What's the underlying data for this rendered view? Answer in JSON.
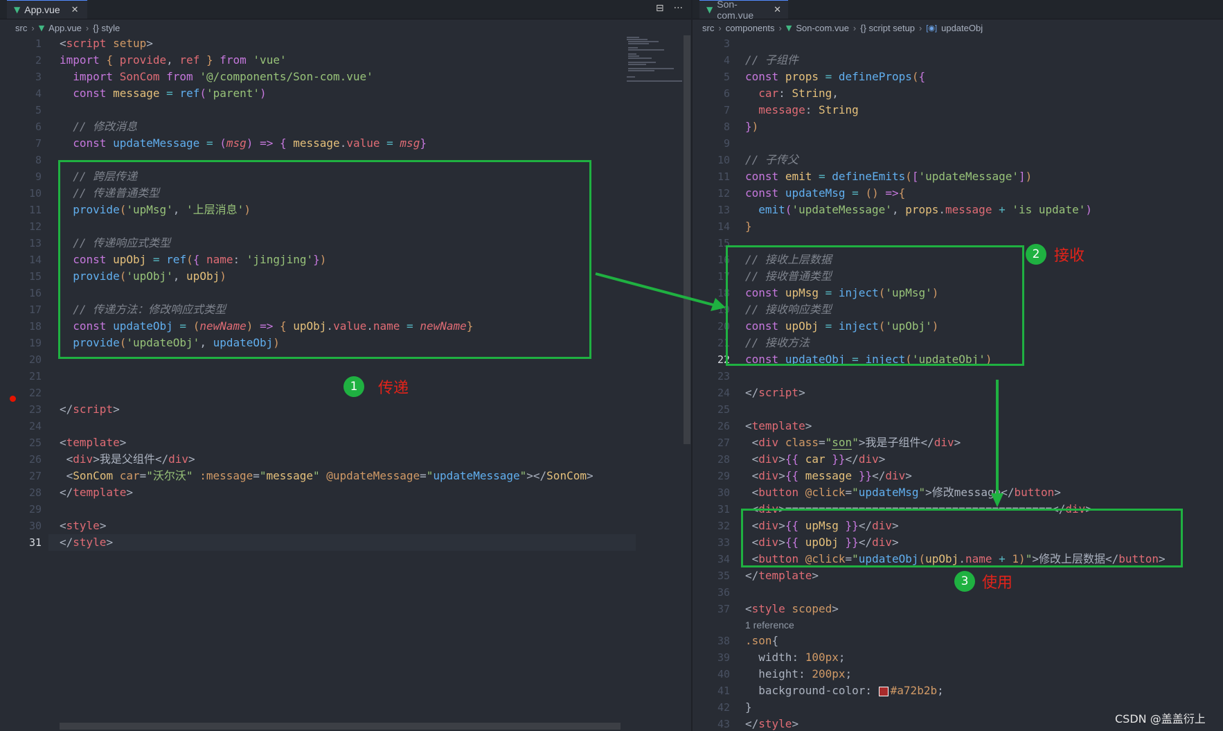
{
  "left": {
    "tab": {
      "label": "App.vue",
      "close": "✕"
    },
    "actions": [
      "⊟",
      "···"
    ],
    "breadcrumb": [
      "src",
      "App.vue",
      "{} style"
    ],
    "current_line": 31,
    "breakpoint_line": 22
  },
  "right": {
    "tab": {
      "label": "Son-com.vue",
      "close": "✕"
    },
    "breadcrumb": [
      "src",
      "components",
      "Son-com.vue",
      "{} script setup",
      "updateObj"
    ],
    "current_line": 22,
    "reference_hint": "1 reference"
  },
  "annotations": [
    {
      "number": "1",
      "label": "传递"
    },
    {
      "number": "2",
      "label": "接收"
    },
    {
      "number": "3",
      "label": "使用"
    }
  ],
  "watermark": "CSDN @盖盖衍上",
  "colors": {
    "box": "#1fb141",
    "label": "#e2231a",
    "swatch": "#a72b2b"
  }
}
